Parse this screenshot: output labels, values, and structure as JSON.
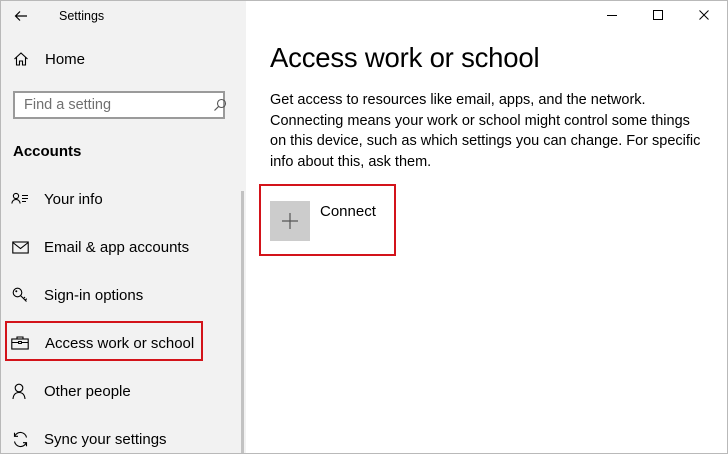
{
  "window": {
    "app_title": "Settings"
  },
  "sidebar": {
    "home_label": "Home",
    "search_placeholder": "Find a setting",
    "section_title": "Accounts",
    "items": [
      {
        "label": "Your info",
        "icon": "contact-card-icon"
      },
      {
        "label": "Email & app accounts",
        "icon": "mail-icon"
      },
      {
        "label": "Sign-in options",
        "icon": "key-icon"
      },
      {
        "label": "Access work or school",
        "icon": "briefcase-icon",
        "selected": true
      },
      {
        "label": "Other people",
        "icon": "person-icon"
      },
      {
        "label": "Sync your settings",
        "icon": "sync-icon"
      }
    ]
  },
  "main": {
    "title": "Access work or school",
    "description": "Get access to resources like email, apps, and the network. Connecting means your work or school might control some things on this device, such as which settings you can change. For specific info about this, ask them.",
    "connect_label": "Connect"
  },
  "colors": {
    "sidebar_bg": "#f2f2f2",
    "highlight": "#d3131a",
    "tile_bg": "#cccccc"
  }
}
